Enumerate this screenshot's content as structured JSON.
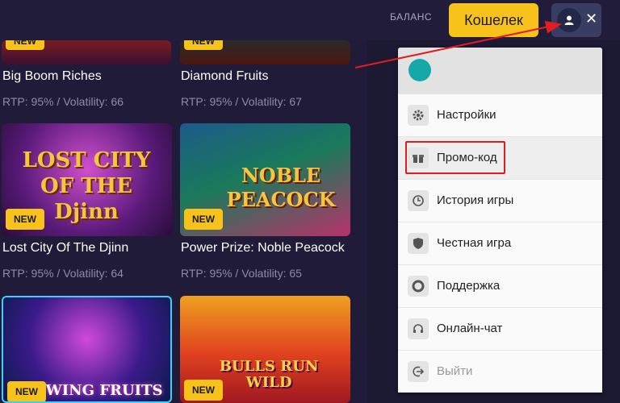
{
  "header": {
    "balance_label": "БАЛАНС",
    "wallet_label": "Кошелек",
    "close_symbol": "✕"
  },
  "games": [
    {
      "title": "Big Boom Riches",
      "meta": "RTP: 95% / Volatility: 66",
      "badge": "NEW"
    },
    {
      "title": "Diamond Fruits",
      "meta": "RTP: 95% / Volatility: 67",
      "badge": "NEW"
    },
    {
      "title": "Lost City Of The Djinn",
      "meta": "RTP: 95% / Volatility: 64",
      "badge": "NEW",
      "art_text": "LOST CITY OF THE Djinn"
    },
    {
      "title": "Power Prize: Noble Peacock",
      "meta": "RTP: 95% / Volatility: 65",
      "badge": "NEW",
      "art_text": "NOBLE PEACOCK"
    },
    {
      "title": "Swing Fruits",
      "badge": "NEW",
      "art_text": "WING FRUITS"
    },
    {
      "title": "Bulls Run Wild",
      "badge": "NEW",
      "art_text": "BULLS RUN WILD"
    }
  ],
  "menu": {
    "items": [
      {
        "label": "Настройки",
        "icon": "gear-icon"
      },
      {
        "label": "Промо-код",
        "icon": "gift-icon"
      },
      {
        "label": "История игры",
        "icon": "clock-icon"
      },
      {
        "label": "Честная игра",
        "icon": "shield-icon"
      },
      {
        "label": "Поддержка",
        "icon": "lifebuoy-icon"
      },
      {
        "label": "Онлайн-чат",
        "icon": "headset-icon"
      },
      {
        "label": "Выйти",
        "icon": "logout-icon"
      }
    ]
  },
  "colors": {
    "accent": "#f7c21a",
    "background": "#1f1b38",
    "highlight": "#e21c22",
    "teal": "#16a8a8"
  }
}
